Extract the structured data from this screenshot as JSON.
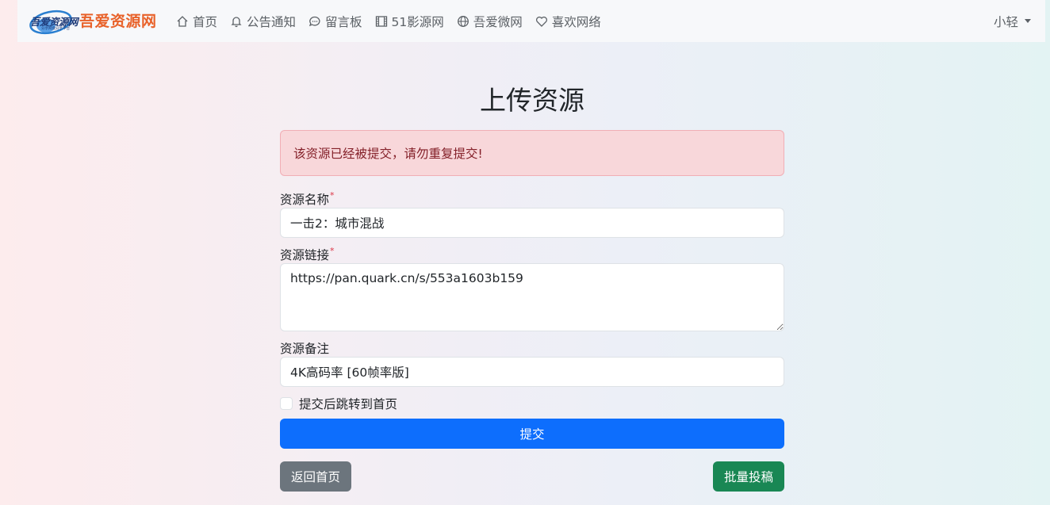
{
  "brand": {
    "logo_text": "吾爱资源网",
    "logo_subtext": "分享网盘分享平台",
    "title": "吾爱资源网",
    "title_color": "#e8622a"
  },
  "nav": {
    "items": [
      {
        "label": "首页",
        "icon": "home-icon"
      },
      {
        "label": "公告通知",
        "icon": "bell-icon"
      },
      {
        "label": "留言板",
        "icon": "chat-icon"
      },
      {
        "label": "51影源网",
        "icon": "film-icon"
      },
      {
        "label": "吾爱微网",
        "icon": "globe-icon"
      },
      {
        "label": "喜欢网络",
        "icon": "heart-icon"
      }
    ],
    "user": "小轻"
  },
  "page": {
    "title": "上传资源"
  },
  "alert": {
    "message": "该资源已经被提交，请勿重复提交!",
    "color": "#842029"
  },
  "form": {
    "name_label": "资源名称",
    "name_value": "一击2：城市混战",
    "link_label": "资源链接",
    "link_value": "https://pan.quark.cn/s/553a1603b159",
    "note_label": "资源备注",
    "note_value": "4K高码率 [60帧率版]",
    "required_mark": "*",
    "redirect_label": "提交后跳转到首页",
    "submit_label": "提交",
    "back_label": "返回首页",
    "batch_label": "批量投稿"
  },
  "colors": {
    "primary": "#0d6efd",
    "secondary": "#6c757d",
    "success": "#198754"
  }
}
